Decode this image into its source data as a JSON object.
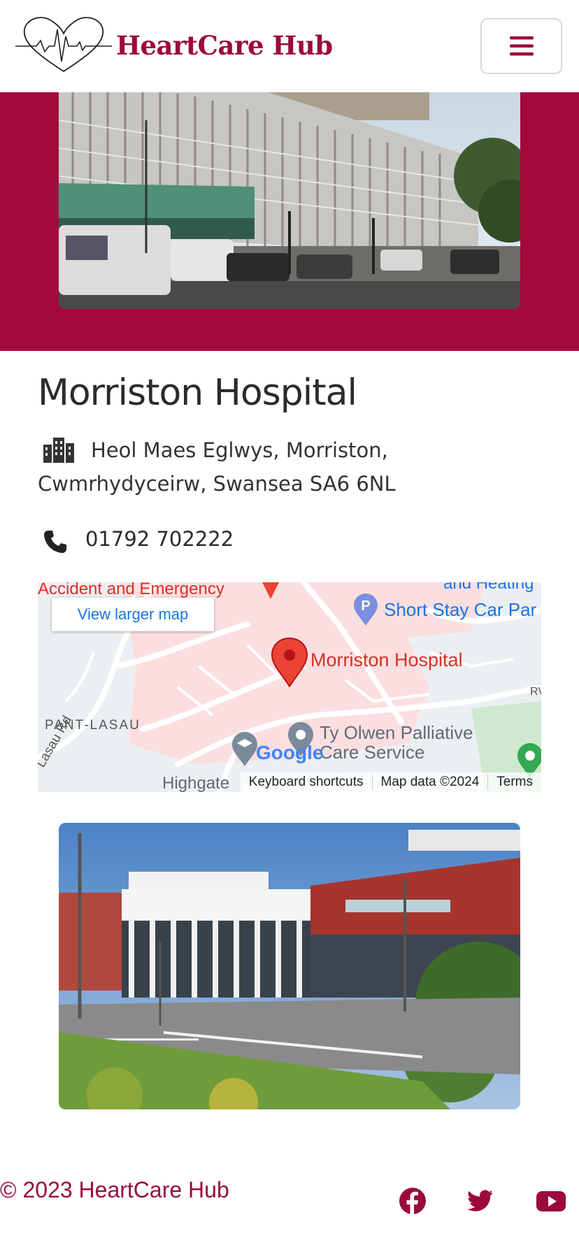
{
  "header": {
    "brand_name": "HeartCare Hub",
    "logo_icon": "heart-pulse-logo",
    "menu_icon": "hamburger-menu-icon"
  },
  "hospital": {
    "name": "Morriston Hospital",
    "address": "Heol Maes Eglwys, Morriston, Cwmrhydyceirw, Swansea SA6 6NL",
    "address_icon": "city-icon",
    "phone": "01792 702222",
    "phone_icon": "phone-icon"
  },
  "map": {
    "view_larger_label": "View larger map",
    "places": {
      "main": "Morriston Hospital",
      "parking": "Short Stay Car Par",
      "emergency": "Accident and Emergency",
      "palliative_line1": "Ty Olwen Palliative",
      "palliative_line2": "Care Service",
      "area": "PANT-LASAU",
      "road": "Lasau Rd",
      "highgate": "Highgate",
      "top_right": "and Heating",
      "rv": "RV"
    },
    "google_logo": "Google",
    "footer": {
      "shortcuts": "Keyboard shortcuts",
      "data": "Map data ©2024",
      "terms": "Terms"
    }
  },
  "footer": {
    "copyright": "© 2023 HeartCare Hub",
    "social": [
      "facebook-icon",
      "twitter-icon",
      "youtube-icon"
    ]
  },
  "colors": {
    "brand": "#9b0a3c",
    "hero_bg": "#a20a3b",
    "map_link": "#1a73e8"
  }
}
